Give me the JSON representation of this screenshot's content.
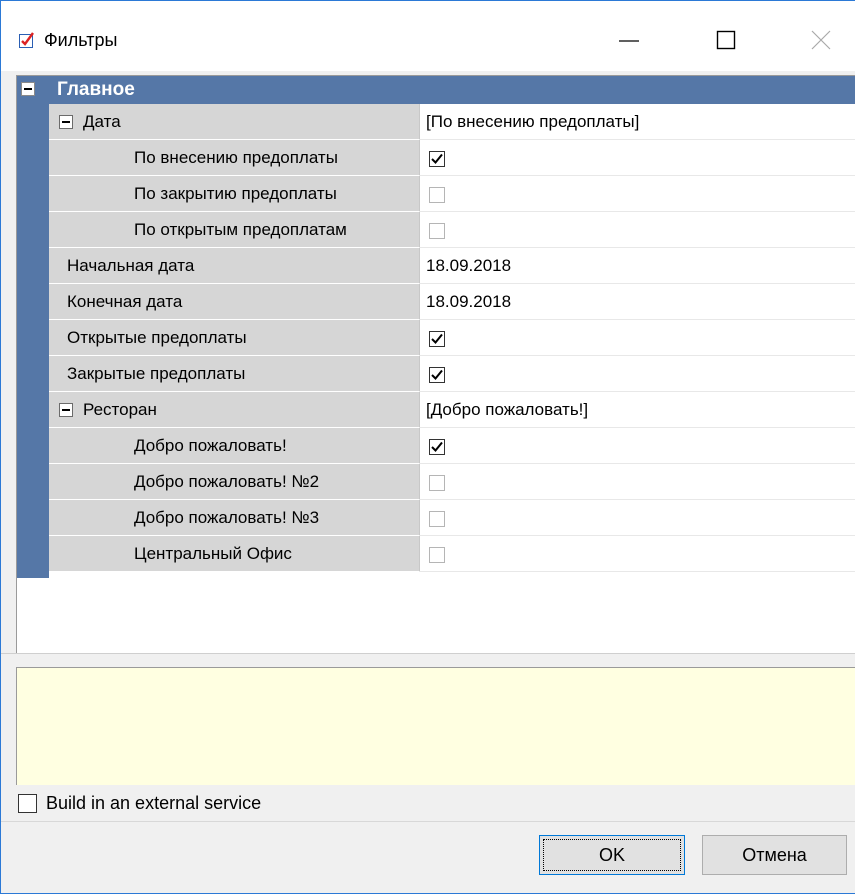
{
  "window": {
    "title": "Фильтры",
    "icon": "checkbox-app-icon",
    "controls": {
      "minimize": "minimize-icon",
      "maximize": "maximize-icon",
      "close": "close-icon"
    }
  },
  "grid": {
    "category": "Главное",
    "rows": [
      {
        "label": "Дата",
        "value": "[По внесению предоплаты]",
        "expander": true
      },
      {
        "label": "По внесению предоплаты",
        "checked": true
      },
      {
        "label": "По закрытию предоплаты",
        "checked": false
      },
      {
        "label": "По открытым предоплатам",
        "checked": false
      },
      {
        "label": "Начальная дата",
        "value": "18.09.2018"
      },
      {
        "label": "Конечная дата",
        "value": "18.09.2018"
      },
      {
        "label": "Открытые предоплаты",
        "checked": true
      },
      {
        "label": "Закрытые предоплаты",
        "checked": true
      },
      {
        "label": "Ресторан",
        "value": "[Добро пожаловать!]",
        "expander": true
      },
      {
        "label": "Добро пожаловать!",
        "checked": true
      },
      {
        "label": "Добро пожаловать! №2",
        "checked": false
      },
      {
        "label": "Добро пожаловать! №3",
        "checked": false
      },
      {
        "label": "Центральный Офис",
        "checked": false
      }
    ]
  },
  "external_service": {
    "label": "Build in an external service",
    "checked": false
  },
  "buttons": {
    "ok": "OK",
    "cancel": "Отмена"
  },
  "colors": {
    "category_bg": "#5577a7",
    "name_bg": "#d6d6d6",
    "description_bg": "#ffffe1",
    "focus_border": "#0078d7"
  }
}
